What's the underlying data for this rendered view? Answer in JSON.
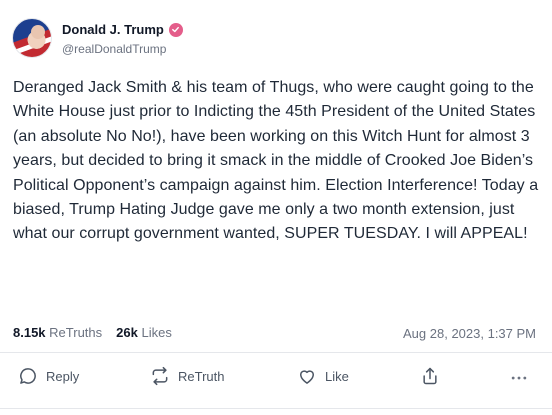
{
  "author": {
    "display_name": "Donald J. Trump",
    "handle": "@realDonaldTrump",
    "avatar_icon": "profile-avatar",
    "verified_icon": "verified-badge-icon",
    "verified_color": "#e45d8a"
  },
  "post": {
    "text": "Deranged Jack Smith & his team of Thugs, who were caught going to the White House just prior to Indicting the 45th President of the United States (an absolute No No!), have been working on this Witch Hunt for almost 3 years, but decided to bring it smack in the middle of Crooked Joe Biden’s Political Opponent’s campaign against him. Election Interference! Today a biased, Trump Hating Judge gave me only a two month extension, just what our corrupt government wanted, SUPER TUESDAY. I will APPEAL!"
  },
  "stats": {
    "retruths_count": "8.15k",
    "retruths_label": "ReTruths",
    "likes_count": "26k",
    "likes_label": "Likes",
    "timestamp": "Aug 28, 2023, 1:37 PM"
  },
  "actions": {
    "reply_label": "Reply",
    "retruth_label": "ReTruth",
    "like_label": "Like",
    "share_icon": "share-icon",
    "more_icon": "more-icon"
  }
}
